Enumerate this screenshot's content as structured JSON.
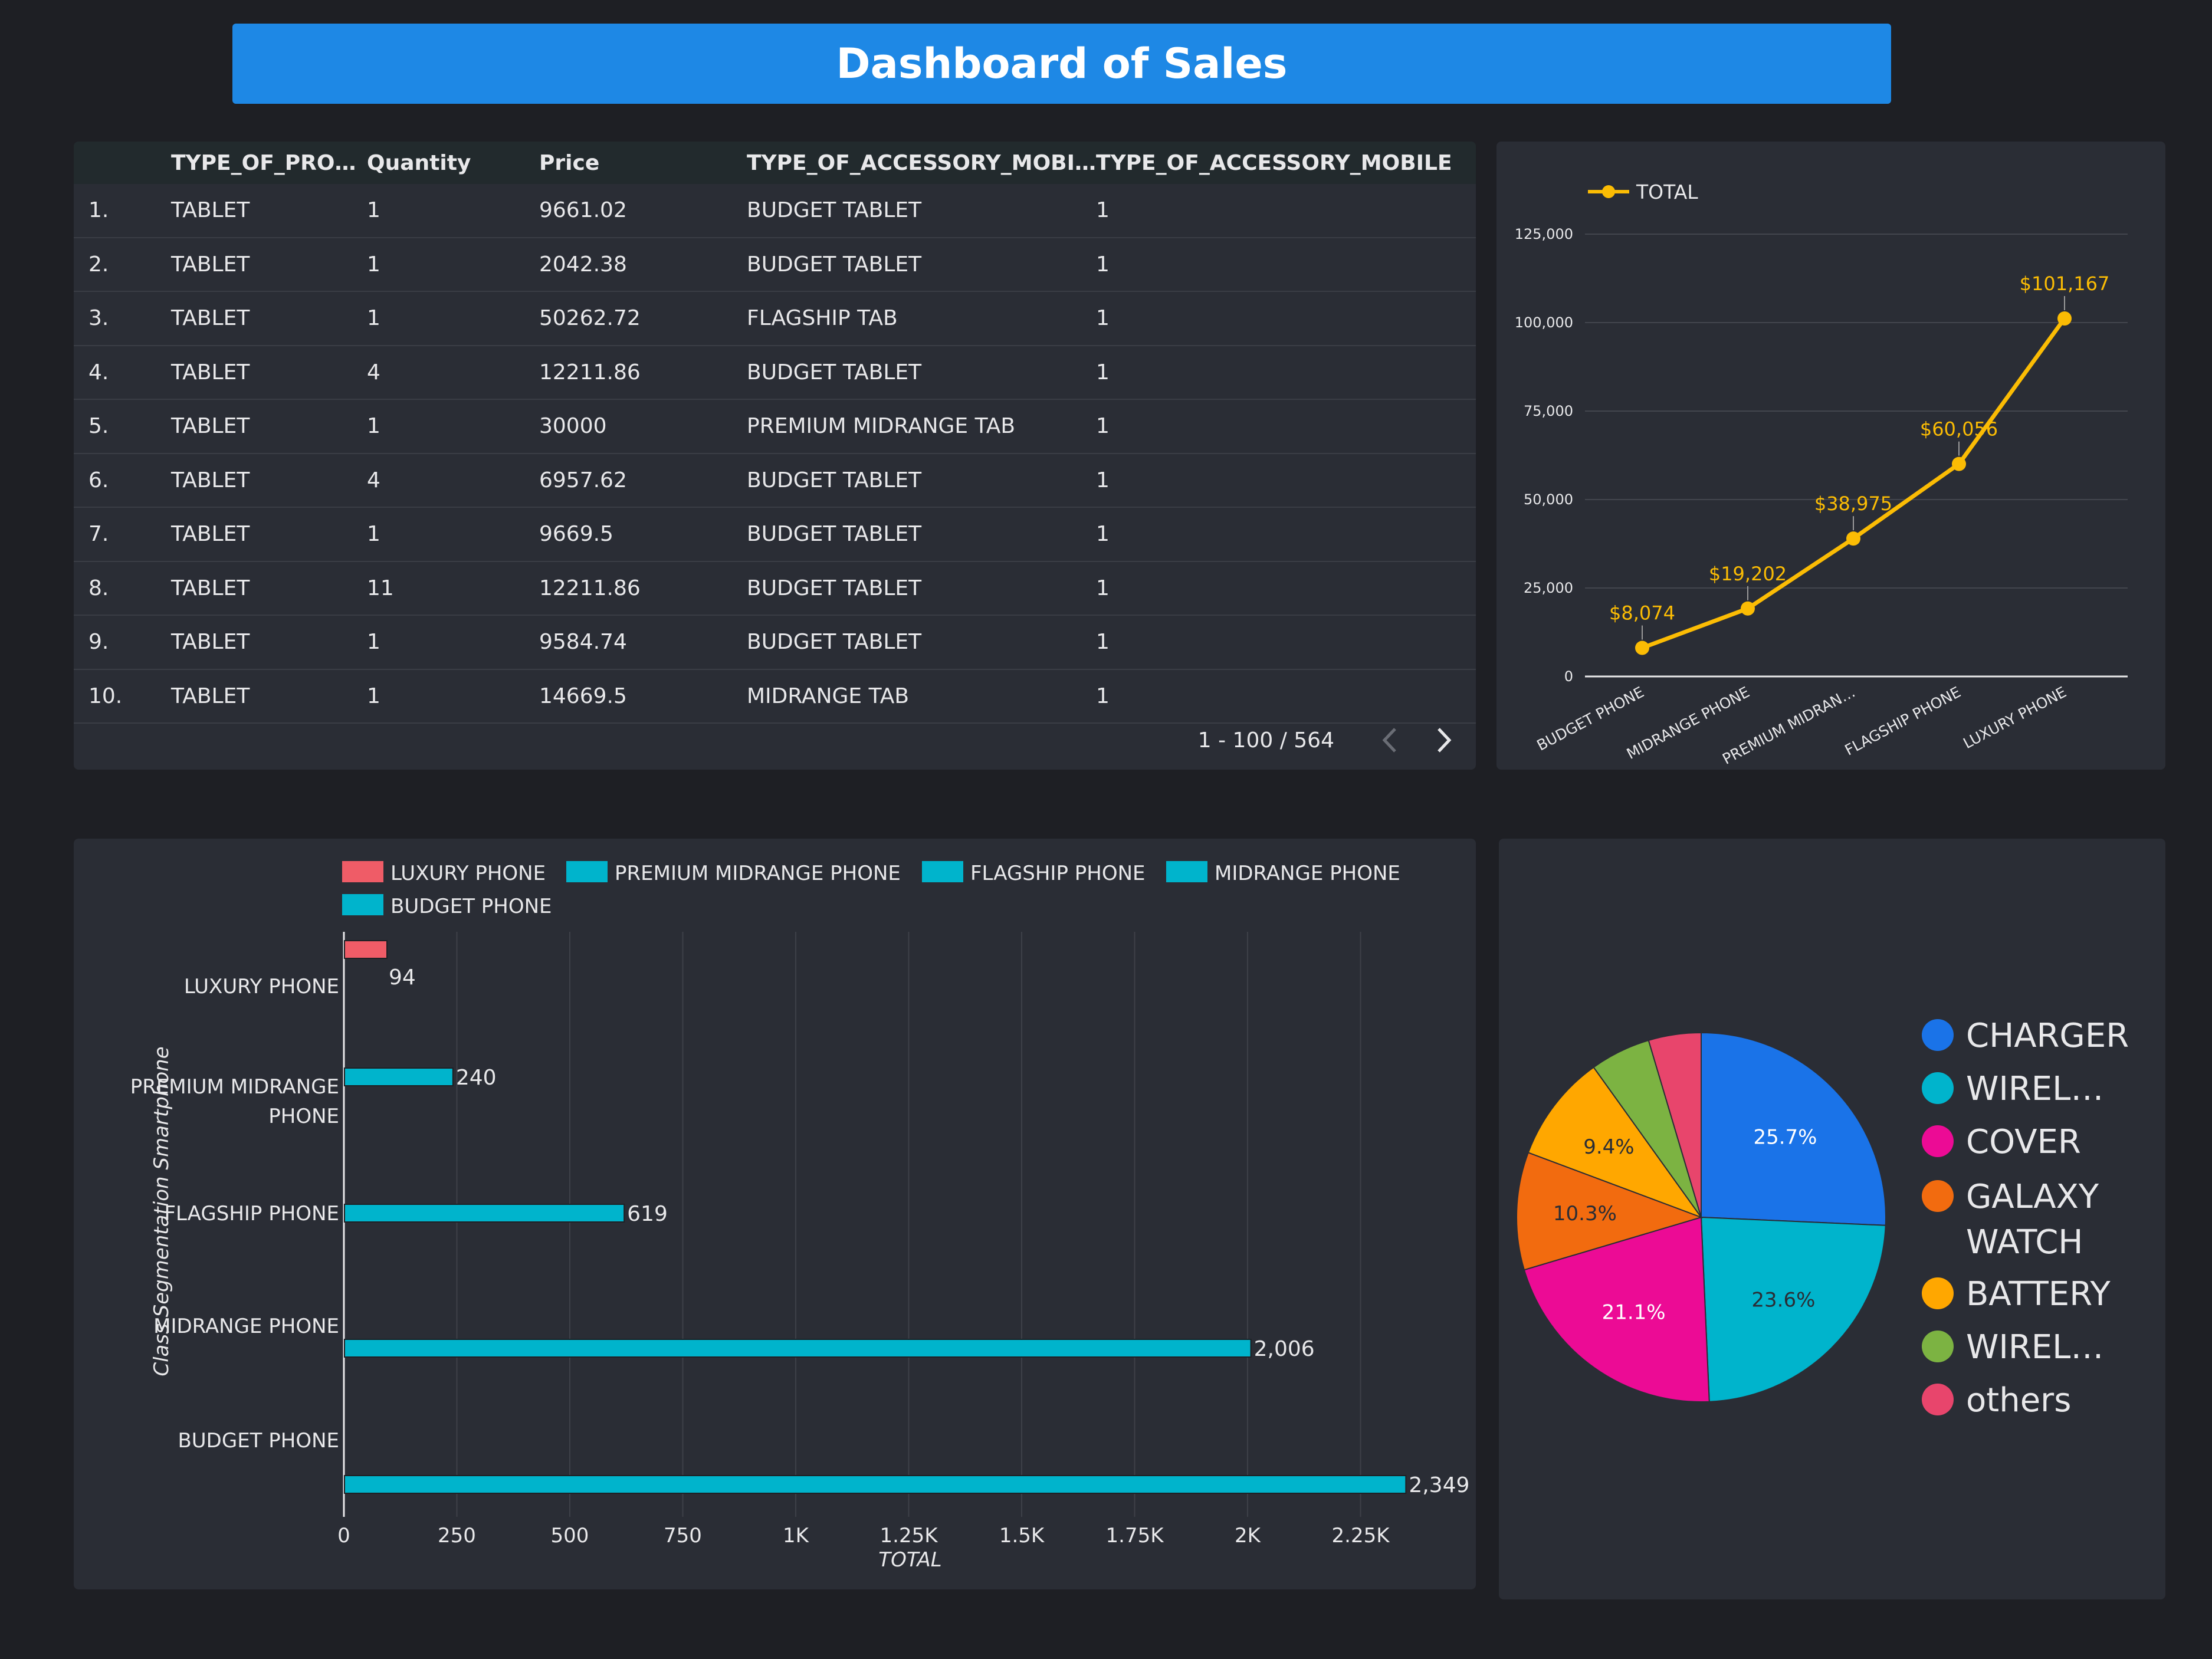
{
  "header": {
    "title": "Dashboard of Sales"
  },
  "table": {
    "columns": [
      "",
      "TYPE_OF_PRO…",
      "Quantity",
      "Price",
      "TYPE_OF_ACCESSORY_MOBI…",
      "TYPE_OF_ACCESSORY_MOBILE"
    ],
    "rows": [
      [
        "1.",
        "TABLET",
        "1",
        "9661.02",
        "BUDGET TABLET",
        "1"
      ],
      [
        "2.",
        "TABLET",
        "1",
        "2042.38",
        "BUDGET TABLET",
        "1"
      ],
      [
        "3.",
        "TABLET",
        "1",
        "50262.72",
        "FLAGSHIP TAB",
        "1"
      ],
      [
        "4.",
        "TABLET",
        "4",
        "12211.86",
        "BUDGET TABLET",
        "1"
      ],
      [
        "5.",
        "TABLET",
        "1",
        "30000",
        "PREMIUM MIDRANGE TAB",
        "1"
      ],
      [
        "6.",
        "TABLET",
        "4",
        "6957.62",
        "BUDGET TABLET",
        "1"
      ],
      [
        "7.",
        "TABLET",
        "1",
        "9669.5",
        "BUDGET TABLET",
        "1"
      ],
      [
        "8.",
        "TABLET",
        "11",
        "12211.86",
        "BUDGET TABLET",
        "1"
      ],
      [
        "9.",
        "TABLET",
        "1",
        "9584.74",
        "BUDGET TABLET",
        "1"
      ],
      [
        "10.",
        "TABLET",
        "1",
        "14669.5",
        "MIDRANGE TAB",
        "1"
      ]
    ],
    "pagination": {
      "text": "1 - 100 / 564",
      "prev_icon": "chevron-left-icon",
      "next_icon": "chevron-right-icon"
    }
  },
  "chart_data": [
    {
      "type": "line",
      "legend": [
        "TOTAL"
      ],
      "legend_position": "top-left",
      "categories": [
        "BUDGET PHONE",
        "MIDRANGE PHONE",
        "PREMIUM MIDRAN…",
        "FLAGSHIP PHONE",
        "LUXURY PHONE"
      ],
      "series": [
        {
          "name": "TOTAL",
          "values": [
            8074,
            19202,
            38975,
            60056,
            101167
          ]
        }
      ],
      "data_labels": [
        "$8,074",
        "$19,202",
        "$38,975",
        "$60,056",
        "$101,167"
      ],
      "y_ticks": [
        "0",
        "25,000",
        "50,000",
        "75,000",
        "100,000",
        "125,000"
      ],
      "ylim": [
        0,
        125000
      ],
      "grid": true,
      "color": "#fbbc04"
    },
    {
      "type": "bar",
      "orientation": "horizontal",
      "categories": [
        "LUXURY PHONE",
        "PREMIUM MIDRANGE PHONE",
        "FLAGSHIP PHONE",
        "MIDRANGE PHONE",
        "BUDGET PHONE"
      ],
      "category_lines": [
        [
          "LUXURY PHONE"
        ],
        [
          "PREMIUM MIDRANGE",
          "PHONE"
        ],
        [
          "FLAGSHIP PHONE"
        ],
        [
          "MIDRANGE PHONE"
        ],
        [
          "BUDGET PHONE"
        ]
      ],
      "values": [
        94,
        240,
        619,
        2006,
        2349
      ],
      "data_labels": [
        "94",
        "240",
        "619",
        "2,006",
        "2,349"
      ],
      "colors": [
        "#ef5c67",
        "#00b4cc",
        "#00b4cc",
        "#00b4cc",
        "#00b4cc"
      ],
      "legend": [
        {
          "label": "LUXURY PHONE",
          "color": "#ef5c67"
        },
        {
          "label": "PREMIUM MIDRANGE PHONE",
          "color": "#00b4cc"
        },
        {
          "label": "FLAGSHIP PHONE",
          "color": "#00b4cc"
        },
        {
          "label": "MIDRANGE PHONE",
          "color": "#00b4cc"
        },
        {
          "label": "BUDGET PHONE",
          "color": "#00b4cc"
        }
      ],
      "legend_position": "top",
      "x_ticks": [
        "0",
        "250",
        "500",
        "750",
        "1K",
        "1.25K",
        "1.5K",
        "1.75K",
        "2K",
        "2.25K"
      ],
      "xlim": [
        0,
        2450
      ],
      "xlabel": "TOTAL",
      "ylabel": "Class Segmentation Smartphone",
      "grid": true
    },
    {
      "type": "pie",
      "slices": [
        {
          "label": "CHARGER",
          "value": 25.7,
          "percent_label": "25.7%",
          "color": "#1a73e8"
        },
        {
          "label": "WIREL…",
          "value": 23.6,
          "percent_label": "23.6%",
          "color": "#00b4cc"
        },
        {
          "label": "COVER",
          "value": 21.1,
          "percent_label": "21.1%",
          "color": "#ec0b95"
        },
        {
          "label": "GALAXY WATCH",
          "value": 10.3,
          "percent_label": "10.3%",
          "color": "#f26b0f"
        },
        {
          "label": "BATTERY",
          "value": 9.4,
          "percent_label": "9.4%",
          "color": "#ffa700"
        },
        {
          "label": "WIREL…",
          "value": 5.3,
          "percent_label": "",
          "color": "#7cb342"
        },
        {
          "label": "others",
          "value": 4.6,
          "percent_label": "",
          "color": "#e8456c"
        }
      ],
      "legend_position": "right"
    }
  ]
}
